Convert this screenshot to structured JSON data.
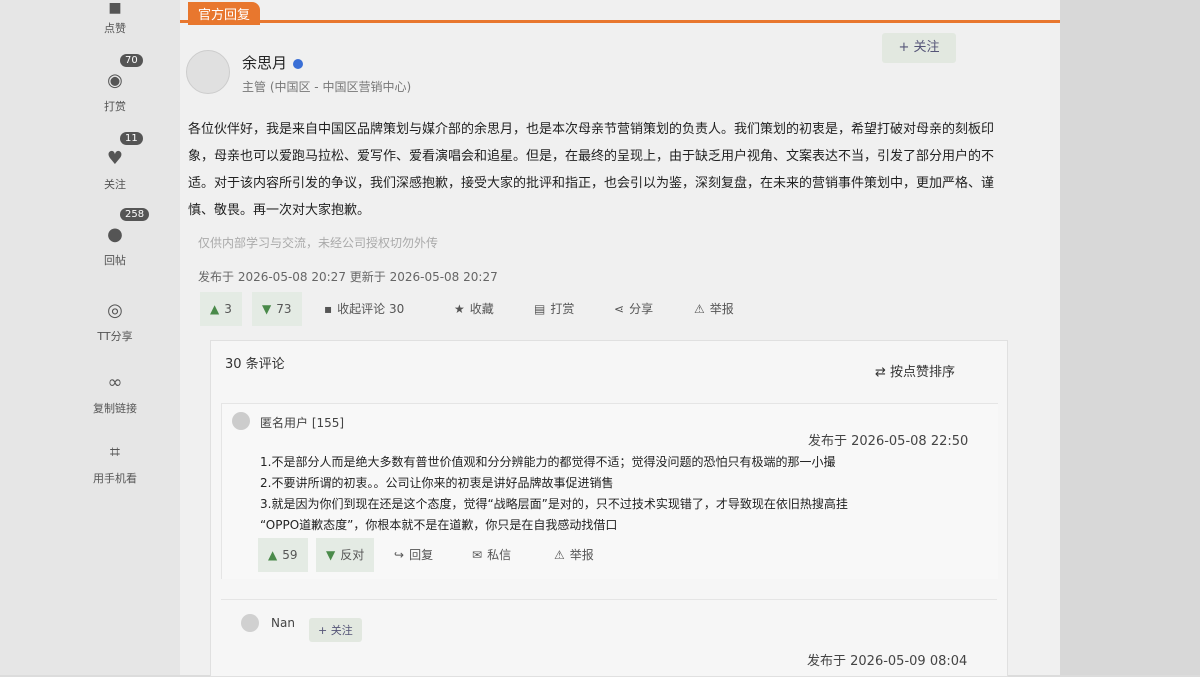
{
  "tag": "官方回复",
  "sidebar": {
    "items": [
      {
        "icon": "like-icon",
        "label": "点赞",
        "count": "70"
      },
      {
        "icon": "coins-icon",
        "label": "打赏",
        "count": "11"
      },
      {
        "icon": "heart-icon",
        "label": "关注",
        "count": "258"
      },
      {
        "icon": "comment-icon",
        "label": "回帖",
        "count": ""
      },
      {
        "icon": "share-icon",
        "label": "TT分享",
        "count": ""
      },
      {
        "icon": "link-icon",
        "label": "复制链接",
        "count": ""
      },
      {
        "icon": "scan-icon",
        "label": "用手机看",
        "count": ""
      }
    ]
  },
  "post": {
    "author": "余思月",
    "role": "主管 (中国区 - 中国区营销中心)",
    "follow_label": "+ 关注",
    "body": "各位伙伴好，我是来自中国区品牌策划与媒介部的余思月，也是本次母亲节营销策划的负责人。我们策划的初衷是，希望打破对母亲的刻板印象，母亲也可以爱跑马拉松、爱写作、爱看演唱会和追星。但是，在最终的呈现上，由于缺乏用户视角、文案表达不当，引发了部分用户的不适。对于该内容所引发的争议，我们深感抱歉，接受大家的批评和指正，也会引以为鉴，深刻复盘，在未来的营销事件策划中，更加严格、谨慎、敬畏。再一次对大家抱歉。",
    "disclaimer": "仅供内部学习与交流，未经公司授权切勿外传",
    "dates": "发布于 2026-05-08 20:27 更新于 2026-05-08 20:27",
    "actions": {
      "like": "3",
      "dislike": "73",
      "collapse_comments": "收起评论 30",
      "favorite": "收藏",
      "tip": "打赏",
      "share": "分享",
      "report": "举报"
    }
  },
  "comments": {
    "count_label": "30 条评论",
    "sort_label": "按点赞排序",
    "list": [
      {
        "user": "匿名用户 [155]",
        "time": "发布于 2026-05-08 22:50",
        "lines": [
          "1.不是部分人而是绝大多数有普世价值观和分分辨能力的都觉得不适；觉得没问题的恐怕只有极端的那一小撮",
          "2.不要讲所谓的初衷。。公司让你来的初衷是讲好品牌故事促进销售",
          "3.就是因为你们到现在还是这个态度，觉得“战略层面”是对的，只不过技术实现错了，才导致现在依旧热搜高挂",
          "“OPPO道歉态度”，你根本就不是在道歉，你只是在自我感动找借口"
        ],
        "likes": "59",
        "oppose": "反对",
        "reply": "回复",
        "message": "私信",
        "report": "举报"
      },
      {
        "user": "Nan",
        "follow": "+ 关注",
        "time": "发布于 2026-05-09 08:04"
      }
    ]
  }
}
